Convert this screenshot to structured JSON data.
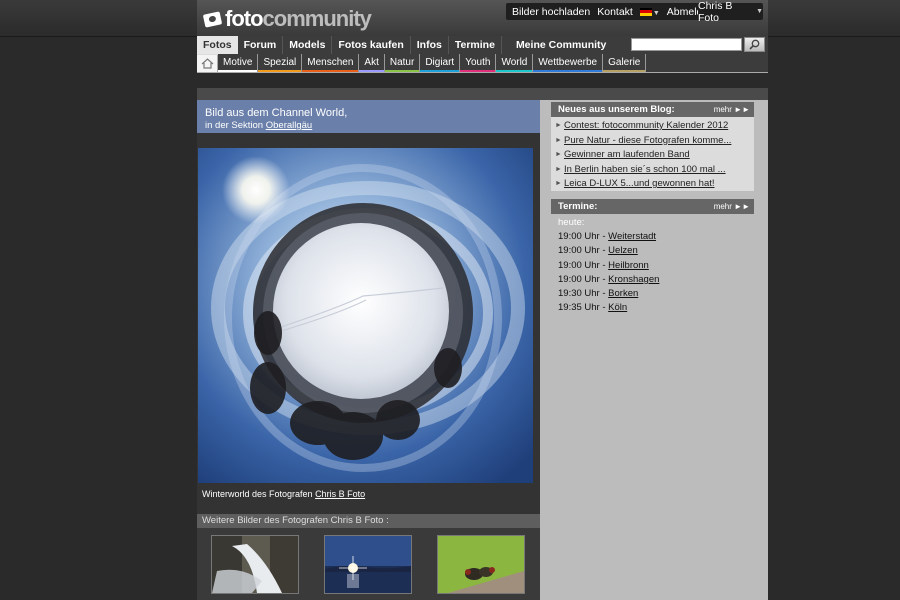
{
  "brand": {
    "logo_part1": "foto",
    "logo_part2": "community"
  },
  "user_bar": {
    "upload": "Bilder hochladen",
    "contact": "Kontakt",
    "logout": "Abmelden",
    "user": "Chris B Foto"
  },
  "nav_main": [
    {
      "label": "Fotos"
    },
    {
      "label": "Forum"
    },
    {
      "label": "Models"
    },
    {
      "label": "Fotos kaufen"
    },
    {
      "label": "Infos"
    },
    {
      "label": "Termine"
    },
    {
      "label": "Meine Community"
    }
  ],
  "search": {
    "placeholder": "",
    "value": ""
  },
  "nav_sub": [
    {
      "label": "Motive",
      "color": "#ffffff"
    },
    {
      "label": "Spezial",
      "color": "#f29b1d"
    },
    {
      "label": "Menschen",
      "color": "#e8601c"
    },
    {
      "label": "Akt",
      "color": "#9a9aff"
    },
    {
      "label": "Natur",
      "color": "#8bc34a"
    },
    {
      "label": "Digiart",
      "color": "#1ea0d9"
    },
    {
      "label": "Youth",
      "color": "#e0307a"
    },
    {
      "label": "World",
      "color": "#1ec8c8"
    },
    {
      "label": "Wettbewerbe",
      "color": "#2e7bd9"
    },
    {
      "label": "Galerie",
      "color": "#b5a264"
    }
  ],
  "channel": {
    "line1": "Bild aus dem Channel World,",
    "line2_prefix": "in der Sektion ",
    "section": "Oberallgäu"
  },
  "caption": {
    "prefix": "Winterworld des Fotografen ",
    "author": "Chris B Foto"
  },
  "more_photos": {
    "heading": "Weitere Bilder des Fotografen Chris B Foto :"
  },
  "blog": {
    "heading": "Neues aus unserem Blog:",
    "more": "mehr",
    "items": [
      "Contest: fotocommunity Kalender 2012",
      "Pure Natur - diese Fotografen komme...",
      "Gewinner am laufenden Band",
      "In Berlin haben sie´s schon 100 mal ...",
      " Leica D-LUX 5...und gewonnen hat!"
    ]
  },
  "termine": {
    "heading": "Termine:",
    "more": "mehr",
    "today": "heute:",
    "events": [
      {
        "time": "19:00 Uhr - ",
        "city": "Weiterstadt"
      },
      {
        "time": "19:00 Uhr - ",
        "city": "Uelzen"
      },
      {
        "time": "19:00 Uhr - ",
        "city": "Heilbronn"
      },
      {
        "time": "19:00 Uhr - ",
        "city": "Kronshagen"
      },
      {
        "time": "19:30 Uhr - ",
        "city": "Borken"
      },
      {
        "time": "19:35 Uhr - ",
        "city": "Köln"
      }
    ]
  },
  "colors": {
    "channel_bg": "#6a7faa",
    "page_bg": "#2a2a2a",
    "sidebar_bg": "#bcbcbc"
  }
}
